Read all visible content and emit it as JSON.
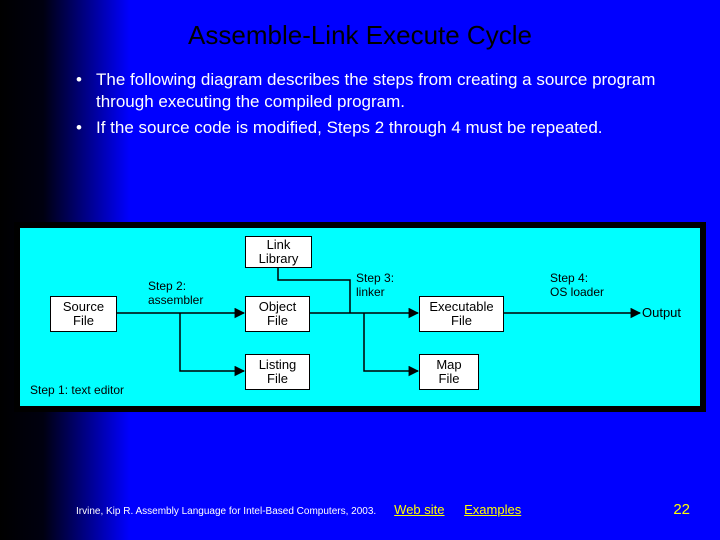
{
  "title": "Assemble-Link Execute Cycle",
  "bullets": [
    "The following diagram describes the steps from creating a source program through executing the compiled program.",
    "If the source code is modified, Steps 2 through 4 must be repeated."
  ],
  "diagram": {
    "boxes": {
      "source_file": "Source\nFile",
      "link_library": "Link\nLibrary",
      "object_file": "Object\nFile",
      "listing_file": "Listing\nFile",
      "executable_file": "Executable\nFile",
      "map_file": "Map\nFile",
      "output": "Output"
    },
    "labels": {
      "step1": "Step 1: text editor",
      "step2": "Step 2:\nassembler",
      "step3": "Step 3:\nlinker",
      "step4": "Step 4:\nOS loader"
    }
  },
  "footer": {
    "citation": "Irvine, Kip R. Assembly Language for Intel-Based Computers, 2003.",
    "link_web": "Web site",
    "link_examples": "Examples",
    "page_number": "22"
  }
}
